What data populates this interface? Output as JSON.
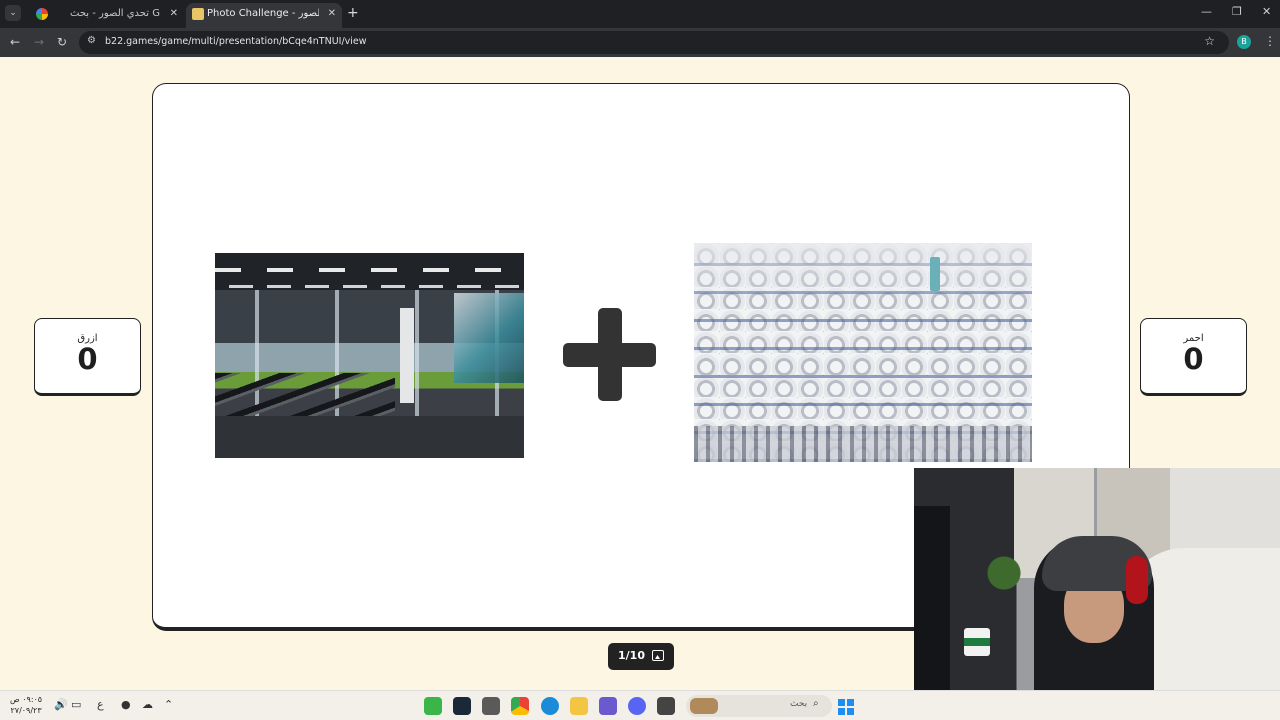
{
  "browser": {
    "tabs": [
      {
        "title": "تحدي الصور - بحث Google",
        "favicon": "google-icon",
        "active": false
      },
      {
        "title": "Photo Challenge - تحدي الصور",
        "favicon": "site-icon",
        "active": true
      }
    ],
    "url": "b22.games/game/multi/presentation/bCqe4nTNUI/view",
    "profile_initial": "B"
  },
  "game": {
    "team_blue": {
      "label": "ازرق",
      "score": "0"
    },
    "team_red": {
      "label": "احمر",
      "score": "0"
    },
    "left_image": "gym-photo",
    "right_image": "tents-photo",
    "operator": "plus-icon",
    "page_indicator": "1/10"
  },
  "taskbar": {
    "time": "٠٩:٠٥ ص",
    "date": "٢٧/٠٩/٢٣",
    "input_lang": "ع",
    "search_placeholder": "بحث"
  },
  "colors": {
    "page_background": "#fdf6e3",
    "card_border": "#222222",
    "pager_background": "#222222",
    "plus": "#333333"
  }
}
